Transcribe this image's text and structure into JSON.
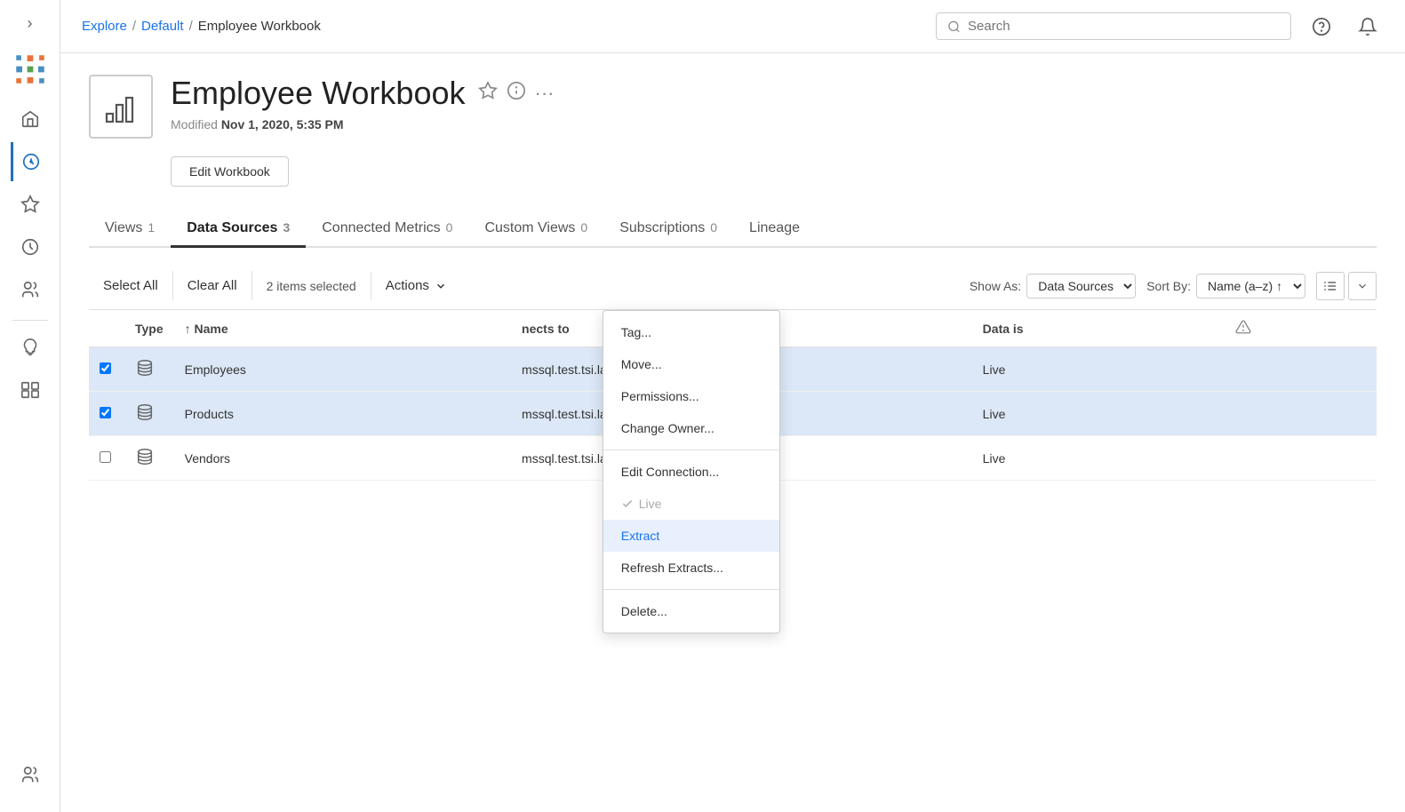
{
  "sidebar": {
    "toggle_icon": "›",
    "items": [
      {
        "id": "logo",
        "icon": "logo",
        "label": "Tableau Logo"
      },
      {
        "id": "home",
        "icon": "home",
        "label": "Home"
      },
      {
        "id": "explore",
        "icon": "explore",
        "label": "Explore",
        "active": true
      },
      {
        "id": "favorites",
        "icon": "star",
        "label": "Favorites"
      },
      {
        "id": "recents",
        "icon": "recents",
        "label": "Recents"
      },
      {
        "id": "groups",
        "icon": "groups",
        "label": "Groups"
      },
      {
        "id": "recommendations",
        "icon": "bulb",
        "label": "Recommendations"
      },
      {
        "id": "collections",
        "icon": "collections",
        "label": "Collections"
      }
    ],
    "bottom_items": [
      {
        "id": "users",
        "icon": "users",
        "label": "Users"
      }
    ]
  },
  "topbar": {
    "breadcrumb": {
      "explore": "Explore",
      "default": "Default",
      "current": "Employee Workbook"
    },
    "search_placeholder": "Search"
  },
  "workbook": {
    "title": "Employee Workbook",
    "modified_label": "Modified",
    "modified_date": "Nov 1, 2020, 5:35 PM",
    "edit_button": "Edit Workbook"
  },
  "tabs": [
    {
      "id": "views",
      "label": "Views",
      "count": "1"
    },
    {
      "id": "data-sources",
      "label": "Data Sources",
      "count": "3",
      "active": true
    },
    {
      "id": "connected-metrics",
      "label": "Connected Metrics",
      "count": "0"
    },
    {
      "id": "custom-views",
      "label": "Custom Views",
      "count": "0"
    },
    {
      "id": "subscriptions",
      "label": "Subscriptions",
      "count": "0"
    },
    {
      "id": "lineage",
      "label": "Lineage",
      "count": ""
    }
  ],
  "toolbar": {
    "select_all": "Select All",
    "clear_all": "Clear All",
    "items_selected": "2 items selected",
    "actions": "Actions",
    "show_as_label": "Show As:",
    "show_as_value": "Data Sources",
    "sort_by_label": "Sort By:",
    "sort_by_value": "Name (a–z) ↑"
  },
  "table": {
    "columns": {
      "type": "Type",
      "name": "↑ Name",
      "connects_to": "nects to",
      "data_is": "Data is",
      "warning": "⚠"
    },
    "rows": [
      {
        "id": "employees",
        "checked": true,
        "name": "Employees",
        "connects_to": "mssql.test.tsi.lan",
        "data_is": "Live"
      },
      {
        "id": "products",
        "checked": true,
        "name": "Products",
        "connects_to": "mssql.test.tsi.lan",
        "data_is": "Live"
      },
      {
        "id": "vendors",
        "checked": false,
        "name": "Vendors",
        "connects_to": "mssql.test.tsi.lan",
        "data_is": "Live"
      }
    ]
  },
  "dropdown_menu": {
    "items": [
      {
        "id": "tag",
        "label": "Tag...",
        "type": "normal"
      },
      {
        "id": "move",
        "label": "Move...",
        "type": "normal"
      },
      {
        "id": "permissions",
        "label": "Permissions...",
        "type": "normal"
      },
      {
        "id": "change-owner",
        "label": "Change Owner...",
        "type": "normal"
      },
      {
        "id": "divider1",
        "type": "divider"
      },
      {
        "id": "edit-connection",
        "label": "Edit Connection...",
        "type": "normal"
      },
      {
        "id": "live",
        "label": "Live",
        "type": "disabled-check"
      },
      {
        "id": "extract",
        "label": "Extract",
        "type": "highlighted"
      },
      {
        "id": "refresh-extracts",
        "label": "Refresh Extracts...",
        "type": "normal"
      },
      {
        "id": "divider2",
        "type": "divider"
      },
      {
        "id": "delete",
        "label": "Delete...",
        "type": "normal"
      }
    ]
  }
}
